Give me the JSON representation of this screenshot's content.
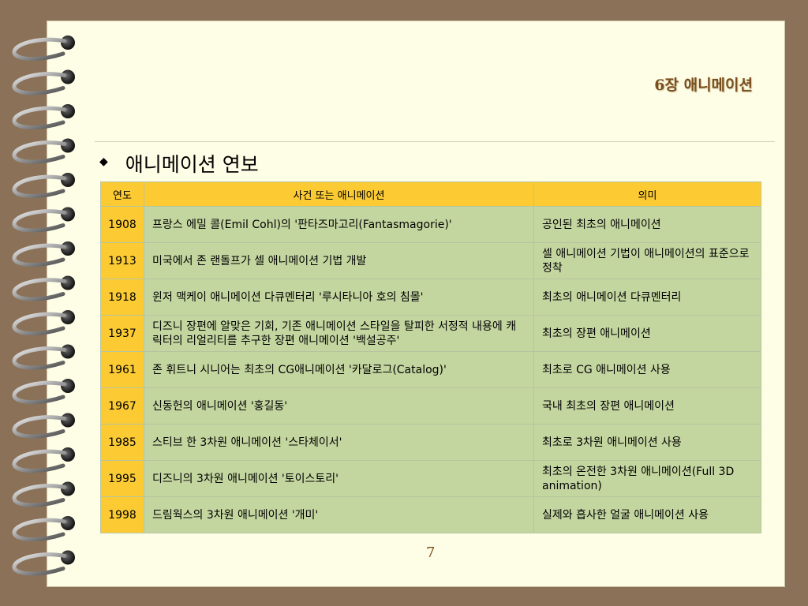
{
  "chapter_title": "6장 애니메이션",
  "heading": "애니메이션 연보",
  "table": {
    "headers": [
      "연도",
      "사건 또는 애니메이션",
      "의미"
    ],
    "rows": [
      {
        "year": "1908",
        "event": "프랑스 에밀 콜(Emil Cohl)의 '판타즈마고리(Fantasmagorie)'",
        "meaning": "공인된 최초의 애니메이션"
      },
      {
        "year": "1913",
        "event": "미국에서 존 랜돌프가 셀 애니메이션 기법 개발",
        "meaning": "셀 애니메이션 기법이 애니메이션의 표준으로 정착"
      },
      {
        "year": "1918",
        "event": "윈저 맥케이 애니메이션 다큐멘터리 '루시타니아 호의 침몰'",
        "meaning": "최초의 애니메이션 다큐멘터리"
      },
      {
        "year": "1937",
        "event": "디즈니 장편에 알맞은 기회, 기존 애니메이션 스타일을 탈피한 서정적 내용에 캐릭터의 리얼리티를 추구한 장편 애니메이션 '백설공주'",
        "meaning": "최초의 장편 애니메이션"
      },
      {
        "year": "1961",
        "event": "존 휘트니 시니어는 최초의 CG애니메이션 '카달로그(Catalog)'",
        "meaning": "최초로 CG 애니메이션 사용"
      },
      {
        "year": "1967",
        "event": "신동헌의 애니메이션 '홍길동'",
        "meaning": "국내 최초의 장편 애니메이션"
      },
      {
        "year": "1985",
        "event": "스티브 한 3차원 애니메이션 '스타체이서'",
        "meaning": "최초로 3차원 애니메이션 사용"
      },
      {
        "year": "1995",
        "event": "디즈니의 3차원 애니메이션 '토이스토리'",
        "meaning": "최초의 온전한 3차원 애니메이션(Full 3D animation)"
      },
      {
        "year": "1998",
        "event": "드림웍스의 3차원 애니메이션 '개미'",
        "meaning": "실제와 흡사한 얼굴 애니메이션 사용"
      }
    ]
  },
  "page_number": "7",
  "colors": {
    "background": "#8b7157",
    "paper": "#fefde6",
    "header_fill": "#fccb33",
    "cell_fill": "#c4d6a0",
    "title_color": "#7a4e1d"
  },
  "icons": [
    "spiral-binding-icon",
    "diamond-bullet-icon"
  ]
}
